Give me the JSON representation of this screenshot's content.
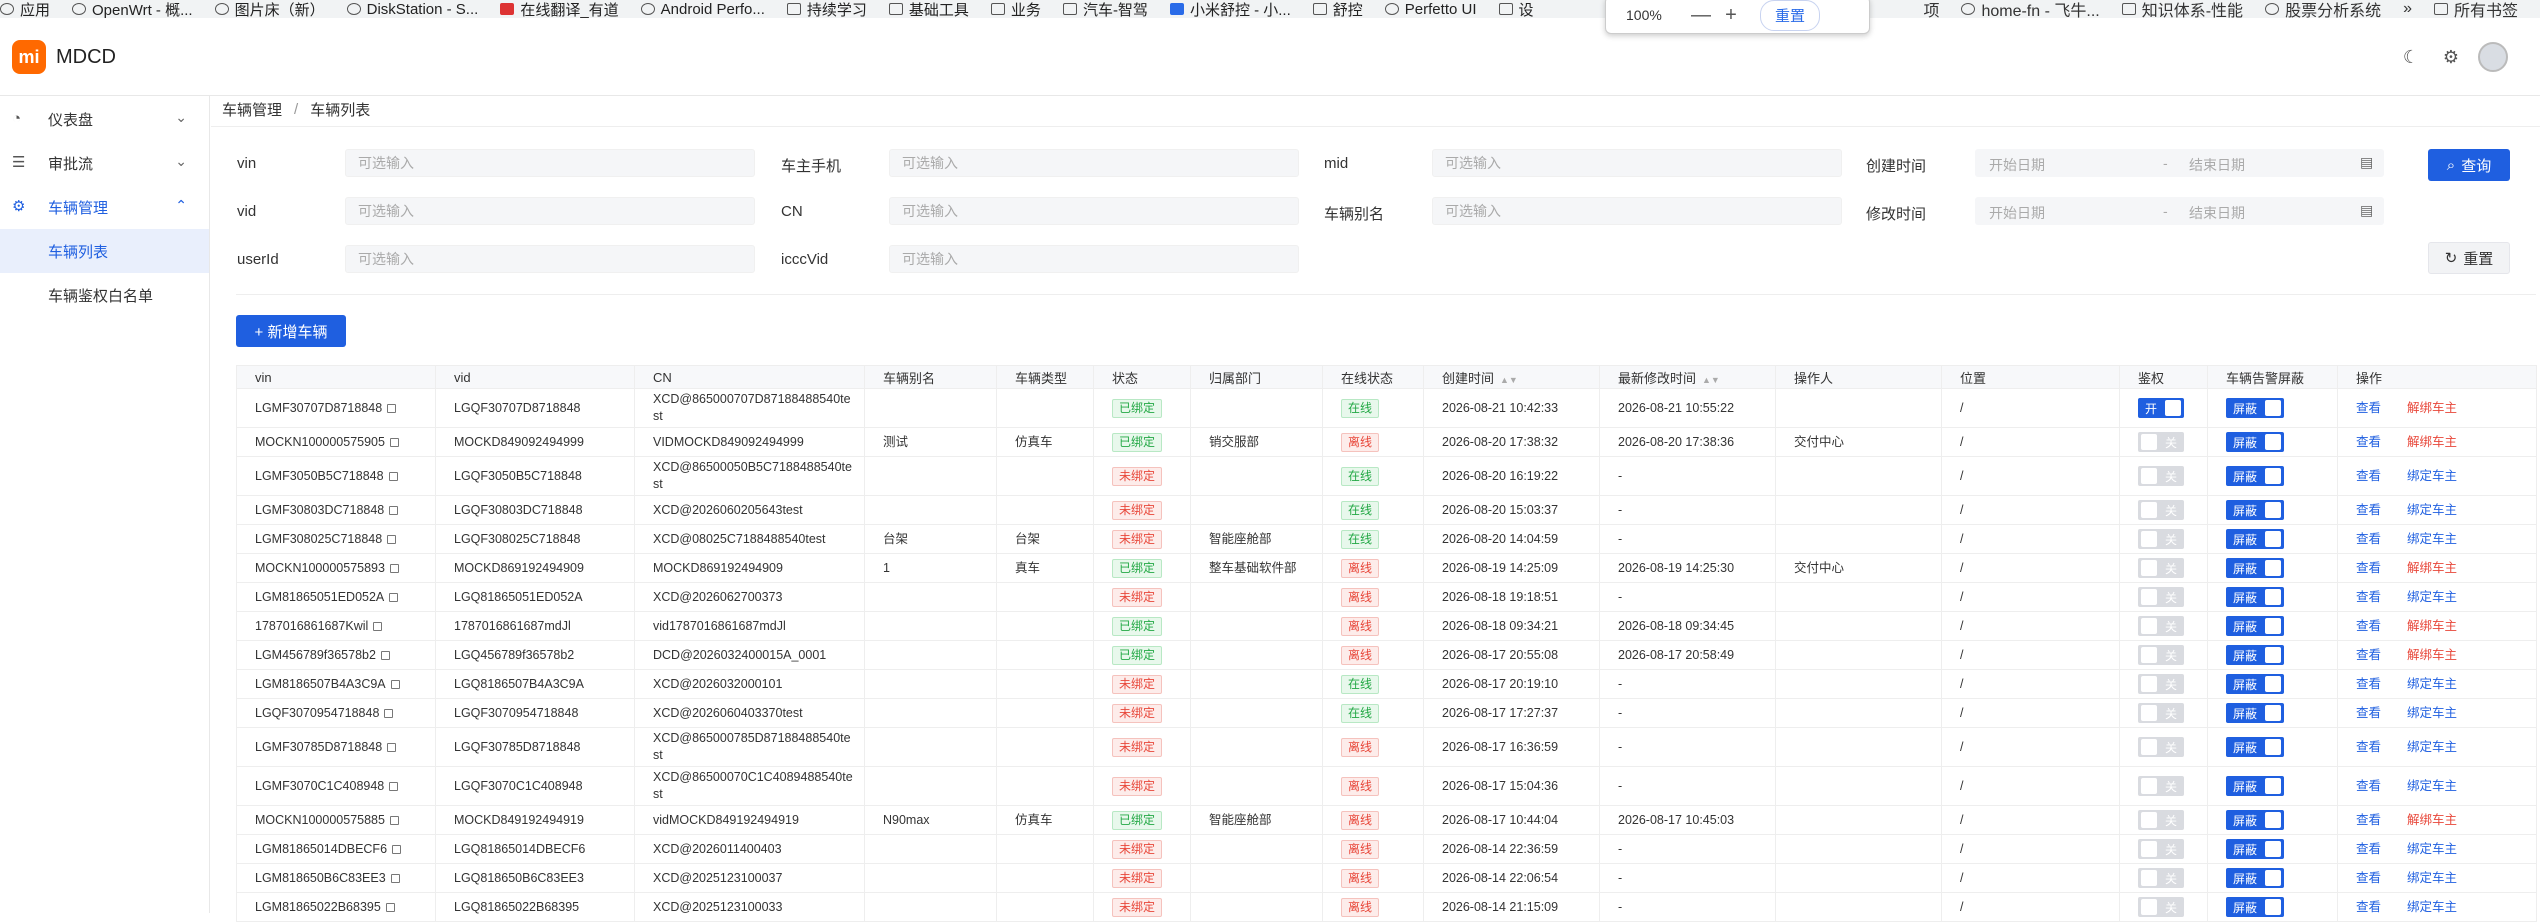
{
  "bookmarks": [
    {
      "label": "应用",
      "icon": "apps-icon"
    },
    {
      "label": "OpenWrt - 概...",
      "icon": "page-icon"
    },
    {
      "label": "图片床（新）",
      "icon": "globe-icon"
    },
    {
      "label": "DiskStation - S...",
      "icon": "page-icon"
    },
    {
      "label": "在线翻译_有道",
      "icon": "youdao-icon"
    },
    {
      "label": "Android Perfo...",
      "icon": "globe-icon"
    },
    {
      "label": "持续学习",
      "icon": "folder-icon"
    },
    {
      "label": "基础工具",
      "icon": "folder-icon"
    },
    {
      "label": "业务",
      "icon": "folder-icon"
    },
    {
      "label": "汽车-智驾",
      "icon": "folder-icon"
    },
    {
      "label": "小米舒控 - 小...",
      "icon": "xiaomi-icon"
    },
    {
      "label": "舒控",
      "icon": "folder-icon"
    },
    {
      "label": "Perfetto UI",
      "icon": "perfetto-icon"
    },
    {
      "label": "设",
      "icon": "folder-icon"
    }
  ],
  "bookmarks_right": [
    {
      "label": "项",
      "icon": ""
    },
    {
      "label": "home-fn - 飞牛...",
      "icon": "globe-icon"
    },
    {
      "label": "知识体系-性能",
      "icon": "folder-icon"
    },
    {
      "label": "股票分析系统",
      "icon": "github-icon"
    }
  ],
  "bookmarks_more": "»",
  "bookmarks_all": "所有书签",
  "zoom": {
    "value": "100%",
    "minus": "—",
    "plus": "+",
    "reset": "重置"
  },
  "app": {
    "logo_text": "mi",
    "title": "MDCD"
  },
  "sidebar": {
    "items": [
      {
        "label": "仪表盘",
        "icon": "dashboard-icon"
      },
      {
        "label": "审批流",
        "icon": "list-icon"
      },
      {
        "label": "车辆管理",
        "icon": "gear-icon"
      }
    ],
    "sub_items": [
      "车辆列表",
      "车辆鉴权白名单"
    ]
  },
  "breadcrumb": {
    "parent": "车辆管理",
    "sep": "/",
    "current": "车辆列表"
  },
  "filters": {
    "vin": {
      "label": "vin",
      "placeholder": "可选输入"
    },
    "owner_phone": {
      "label": "车主手机",
      "placeholder": "可选输入"
    },
    "mid": {
      "label": "mid",
      "placeholder": "可选输入"
    },
    "created": {
      "label": "创建时间",
      "start": "开始日期",
      "sep": "-",
      "end": "结束日期"
    },
    "vid": {
      "label": "vid",
      "placeholder": "可选输入"
    },
    "cn": {
      "label": "CN",
      "placeholder": "可选输入"
    },
    "alias": {
      "label": "车辆别名",
      "placeholder": "可选输入"
    },
    "modified": {
      "label": "修改时间",
      "start": "开始日期",
      "sep": "-",
      "end": "结束日期"
    },
    "userid": {
      "label": "userId",
      "placeholder": "可选输入"
    },
    "icccvid": {
      "label": "icccVid",
      "placeholder": "可选输入"
    },
    "query_label": "查询",
    "reset_label": "重置"
  },
  "add_vehicle_label": "+ 新增车辆",
  "table": {
    "columns": [
      "vin",
      "vid",
      "CN",
      "车辆别名",
      "车辆类型",
      "状态",
      "归属部门",
      "在线状态",
      "创建时间",
      "最新修改时间",
      "操作人",
      "位置",
      "鉴权",
      "车辆告警屏蔽",
      "操作"
    ],
    "view_label": "查看",
    "rows": [
      {
        "vin": "LGMF30707D8718848",
        "vid": "LGQF30707D8718848",
        "cn": "XCD@865000707D87188488540test",
        "alias": "",
        "type": "",
        "status": "已绑定",
        "dept": "",
        "online": "在线",
        "created": "2026-08-21 10:42:33",
        "modified": "2026-08-21 10:55:22",
        "operator": "",
        "location": "/",
        "auth": "开",
        "alarm": "屏蔽",
        "action": "解绑车主"
      },
      {
        "vin": "MOCKN100000575905",
        "vid": "MOCKD849092494999",
        "cn": "VIDMOCKD849092494999",
        "alias": "测试",
        "type": "仿真车",
        "status": "已绑定",
        "dept": "销交服部",
        "online": "离线",
        "created": "2026-08-20 17:38:32",
        "modified": "2026-08-20 17:38:36",
        "operator": "交付中心",
        "location": "/",
        "auth": "关",
        "alarm": "屏蔽",
        "action": "解绑车主"
      },
      {
        "vin": "LGMF3050B5C718848",
        "vid": "LGQF3050B5C718848",
        "cn": "XCD@86500050B5C7188488540test",
        "alias": "",
        "type": "",
        "status": "未绑定",
        "dept": "",
        "online": "在线",
        "created": "2026-08-20 16:19:22",
        "modified": "-",
        "operator": "",
        "location": "/",
        "auth": "关",
        "alarm": "屏蔽",
        "action": "绑定车主"
      },
      {
        "vin": "LGMF30803DC718848",
        "vid": "LGQF30803DC718848",
        "cn": "XCD@2026060205643test",
        "alias": "",
        "type": "",
        "status": "未绑定",
        "dept": "",
        "online": "在线",
        "created": "2026-08-20 15:03:37",
        "modified": "-",
        "operator": "",
        "location": "/",
        "auth": "关",
        "alarm": "屏蔽",
        "action": "绑定车主"
      },
      {
        "vin": "LGMF308025C718848",
        "vid": "LGQF308025C718848",
        "cn": "XCD@08025C7188488540test",
        "alias": "台架",
        "type": "台架",
        "status": "未绑定",
        "dept": "智能座舱部",
        "online": "在线",
        "created": "2026-08-20 14:04:59",
        "modified": "-",
        "operator": "",
        "location": "/",
        "auth": "关",
        "alarm": "屏蔽",
        "action": "绑定车主"
      },
      {
        "vin": "MOCKN100000575893",
        "vid": "MOCKD869192494909",
        "cn": "MOCKD869192494909",
        "alias": "1",
        "type": "真车",
        "status": "已绑定",
        "dept": "整车基础软件部",
        "online": "离线",
        "created": "2026-08-19 14:25:09",
        "modified": "2026-08-19 14:25:30",
        "operator": "交付中心",
        "location": "/",
        "auth": "关",
        "alarm": "屏蔽",
        "action": "解绑车主"
      },
      {
        "vin": "LGM81865051ED052A",
        "vid": "LGQ81865051ED052A",
        "cn": "XCD@2026062700373",
        "alias": "",
        "type": "",
        "status": "未绑定",
        "dept": "",
        "online": "离线",
        "created": "2026-08-18 19:18:51",
        "modified": "-",
        "operator": "",
        "location": "/",
        "auth": "关",
        "alarm": "屏蔽",
        "action": "绑定车主"
      },
      {
        "vin": "1787016861687Kwil",
        "vid": "1787016861687mdJl",
        "cn": "vid1787016861687mdJl",
        "alias": "",
        "type": "",
        "status": "已绑定",
        "dept": "",
        "online": "离线",
        "created": "2026-08-18 09:34:21",
        "modified": "2026-08-18 09:34:45",
        "operator": "",
        "location": "/",
        "auth": "关",
        "alarm": "屏蔽",
        "action": "解绑车主"
      },
      {
        "vin": "LGM456789f36578b2",
        "vid": "LGQ456789f36578b2",
        "cn": "DCD@2026032400015A_0001",
        "alias": "",
        "type": "",
        "status": "已绑定",
        "dept": "",
        "online": "离线",
        "created": "2026-08-17 20:55:08",
        "modified": "2026-08-17 20:58:49",
        "operator": "",
        "location": "/",
        "auth": "关",
        "alarm": "屏蔽",
        "action": "解绑车主"
      },
      {
        "vin": "LGM8186507B4A3C9A",
        "vid": "LGQ8186507B4A3C9A",
        "cn": "XCD@2026032000101",
        "alias": "",
        "type": "",
        "status": "未绑定",
        "dept": "",
        "online": "在线",
        "created": "2026-08-17 20:19:10",
        "modified": "-",
        "operator": "",
        "location": "/",
        "auth": "关",
        "alarm": "屏蔽",
        "action": "绑定车主"
      },
      {
        "vin": "LGQF3070954718848",
        "vid": "LGQF3070954718848",
        "cn": "XCD@2026060403370test",
        "alias": "",
        "type": "",
        "status": "未绑定",
        "dept": "",
        "online": "在线",
        "created": "2026-08-17 17:27:37",
        "modified": "-",
        "operator": "",
        "location": "/",
        "auth": "关",
        "alarm": "屏蔽",
        "action": "绑定车主"
      },
      {
        "vin": "LGMF30785D8718848",
        "vid": "LGQF30785D8718848",
        "cn": "XCD@865000785D87188488540test",
        "alias": "",
        "type": "",
        "status": "未绑定",
        "dept": "",
        "online": "离线",
        "created": "2026-08-17 16:36:59",
        "modified": "-",
        "operator": "",
        "location": "/",
        "auth": "关",
        "alarm": "屏蔽",
        "action": "绑定车主"
      },
      {
        "vin": "LGMF3070C1C408948",
        "vid": "LGQF3070C1C408948",
        "cn": "XCD@86500070C1C4089488540test",
        "alias": "",
        "type": "",
        "status": "未绑定",
        "dept": "",
        "online": "离线",
        "created": "2026-08-17 15:04:36",
        "modified": "-",
        "operator": "",
        "location": "/",
        "auth": "关",
        "alarm": "屏蔽",
        "action": "绑定车主"
      },
      {
        "vin": "MOCKN100000575885",
        "vid": "MOCKD849192494919",
        "cn": "vidMOCKD849192494919",
        "alias": "N90max",
        "type": "仿真车",
        "status": "已绑定",
        "dept": "智能座舱部",
        "online": "离线",
        "created": "2026-08-17 10:44:04",
        "modified": "2026-08-17 10:45:03",
        "operator": "",
        "location": "/",
        "auth": "关",
        "alarm": "屏蔽",
        "action": "解绑车主"
      },
      {
        "vin": "LGM81865014DBECF6",
        "vid": "LGQ81865014DBECF6",
        "cn": "XCD@2026011400403",
        "alias": "",
        "type": "",
        "status": "未绑定",
        "dept": "",
        "online": "离线",
        "created": "2026-08-14 22:36:59",
        "modified": "-",
        "operator": "",
        "location": "/",
        "auth": "关",
        "alarm": "屏蔽",
        "action": "绑定车主"
      },
      {
        "vin": "LGM818650B6C83EE3",
        "vid": "LGQ818650B6C83EE3",
        "cn": "XCD@2025123100037",
        "alias": "",
        "type": "",
        "status": "未绑定",
        "dept": "",
        "online": "离线",
        "created": "2026-08-14 22:06:54",
        "modified": "-",
        "operator": "",
        "location": "/",
        "auth": "关",
        "alarm": "屏蔽",
        "action": "绑定车主"
      },
      {
        "vin": "LGM81865022B68395",
        "vid": "LGQ81865022B68395",
        "cn": "XCD@2025123100033",
        "alias": "",
        "type": "",
        "status": "未绑定",
        "dept": "",
        "online": "离线",
        "created": "2026-08-14 21:15:09",
        "modified": "-",
        "operator": "",
        "location": "/",
        "auth": "关",
        "alarm": "屏蔽",
        "action": "绑定车主"
      }
    ]
  }
}
